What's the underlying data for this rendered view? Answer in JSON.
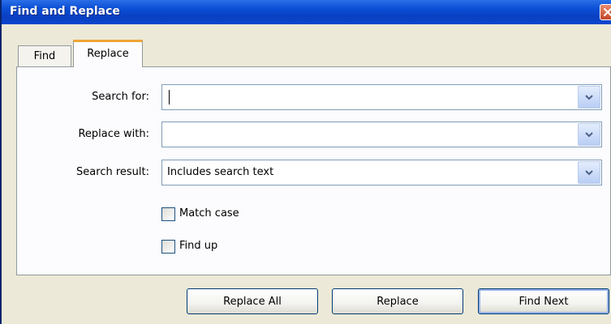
{
  "window": {
    "title": "Find and Replace"
  },
  "tabs": [
    {
      "label": "Find",
      "selected": false
    },
    {
      "label": "Replace",
      "selected": true
    }
  ],
  "form": {
    "search_for": {
      "label": "Search for:",
      "value": ""
    },
    "replace_with": {
      "label": "Replace with:",
      "value": ""
    },
    "search_result": {
      "label": "Search result:",
      "value": "Includes search text"
    }
  },
  "options": {
    "match_case": {
      "label": "Match case",
      "checked": false
    },
    "find_up": {
      "label": "Find up",
      "checked": false
    }
  },
  "buttons": {
    "replace_all": "Replace All",
    "replace": "Replace",
    "find_next": "Find Next"
  },
  "icons": {
    "close": "close-icon",
    "dropdown": "chevron-down-icon"
  },
  "colors": {
    "title_bar": "#0b4fd6",
    "active_tab_accent": "#f0a536",
    "close_button": "#c3462a"
  }
}
